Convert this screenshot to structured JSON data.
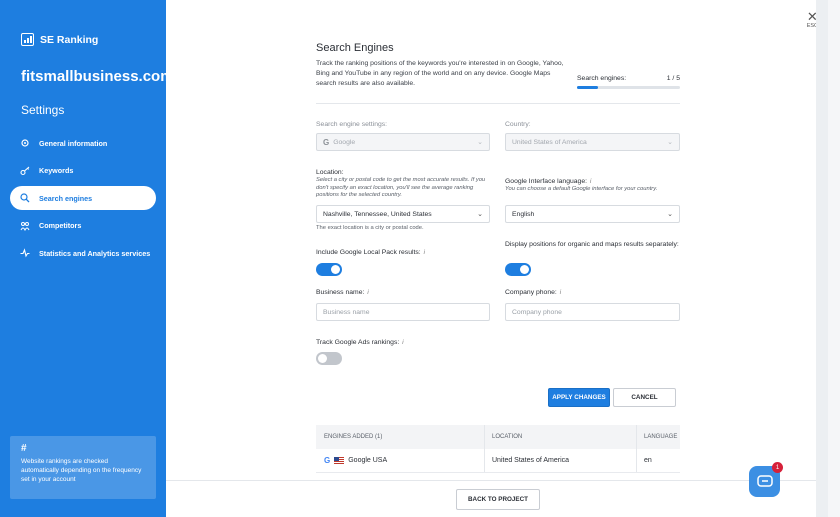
{
  "sidebar": {
    "brand": "SE Ranking",
    "project": "fitsmallbusiness.com",
    "section": "Settings",
    "items": [
      {
        "label": "General information",
        "icon": "gear-icon",
        "active": false
      },
      {
        "label": "Keywords",
        "icon": "key-icon",
        "active": false
      },
      {
        "label": "Search engines",
        "icon": "search-icon",
        "active": true
      },
      {
        "label": "Competitors",
        "icon": "competitors-icon",
        "active": false
      },
      {
        "label": "Statistics and Analytics services",
        "icon": "pulse-icon",
        "active": false
      }
    ],
    "info": {
      "symbol": "#",
      "text": "Website rankings are checked automatically depending on the frequency set in your account"
    }
  },
  "close": {
    "label": "ESC"
  },
  "page": {
    "title": "Search Engines",
    "description": "Track the ranking positions of the keywords you're interested in on Google, Yahoo, Bing and YouTube in any region of the world and on any device. Google Maps search results are also available.",
    "progress_label": "Search engines:",
    "progress_value": "1 / 5",
    "progress_fraction": 0.2
  },
  "form": {
    "engine_settings_label": "Search engine settings:",
    "engine_value": "Google",
    "country_label": "Country:",
    "country_value": "United States of America",
    "location_label": "Location:",
    "location_hint": "Select a city or postal code to get the most accurate results. If you don't specify an exact location, you'll see the average ranking positions for the selected country.",
    "location_value": "Nashville, Tennessee, United States",
    "location_note": "The exact location is a city or postal code.",
    "language_label": "Google Interface language:",
    "language_hint": "You can choose a default Google interface for your country.",
    "language_value": "English",
    "local_pack_label": "Include Google Local Pack results:",
    "local_pack_on": true,
    "separate_label": "Display positions for organic and maps results separately:",
    "separate_on": true,
    "business_name_label": "Business name:",
    "business_name_placeholder": "Business name",
    "company_phone_label": "Company phone:",
    "company_phone_placeholder": "Company phone",
    "ads_label": "Track Google Ads rankings:",
    "ads_on": false,
    "info_symbol": "i"
  },
  "buttons": {
    "apply": "APPLY CHANGES",
    "cancel": "CANCEL",
    "back": "BACK TO PROJECT"
  },
  "table": {
    "headers": [
      "ENGINES ADDED (1)",
      "LOCATION",
      "LANGUAGE"
    ],
    "rows": [
      {
        "engine": "Google USA",
        "location": "United States of America",
        "language": "en"
      }
    ]
  },
  "chat": {
    "badge": "1"
  },
  "colors": {
    "accent": "#1e7ee0",
    "badge": "#d6213a"
  }
}
